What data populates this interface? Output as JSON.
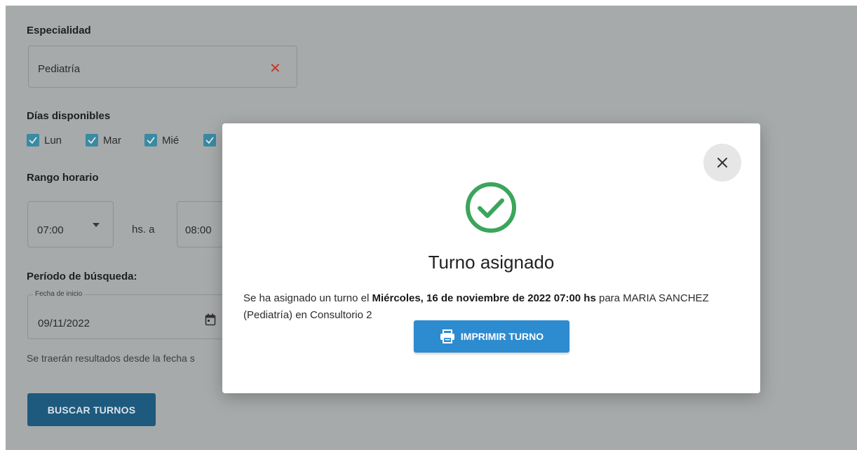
{
  "form": {
    "especialidad": {
      "label": "Especialidad",
      "value": "Pediatría",
      "clear_glyph": "✕"
    },
    "dias": {
      "label": "Días disponibles",
      "items": [
        {
          "label": "Lun",
          "checked": true
        },
        {
          "label": "Mar",
          "checked": true
        },
        {
          "label": "Mié",
          "checked": true
        },
        {
          "label": "",
          "checked": true
        }
      ]
    },
    "rango": {
      "label": "Rango horario",
      "from": "07:00",
      "separator": "hs. a",
      "to": "08:00"
    },
    "periodo": {
      "label": "Período de búsqueda:",
      "start_label": "Fecha de inicio",
      "start_value": "09/11/2022",
      "hint": "Se traerán resultados desde la fecha s"
    },
    "search_button": "BUSCAR TURNOS"
  },
  "modal": {
    "title": "Turno asignado",
    "message_prefix": "Se ha asignado un turno el ",
    "message_bold": "Miércoles, 16 de noviembre de 2022 07:00 hs",
    "message_suffix": " para MARIA SANCHEZ (Pediatría) en Consultorio 2",
    "print_button": "IMPRIMIR TURNO",
    "close_glyph": "✕"
  },
  "colors": {
    "success": "#3ba55c",
    "primary_button": "#2d8bd0",
    "overlay": "#a7aaab",
    "checkbox": "#3a8aa2"
  }
}
